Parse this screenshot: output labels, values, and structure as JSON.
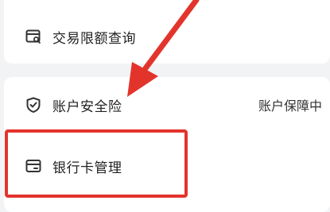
{
  "menu": {
    "items": [
      {
        "id": "trade-limit",
        "label": "交易限额查询",
        "icon": "receipt-search-icon",
        "status": ""
      },
      {
        "id": "account-insurance",
        "label": "账户安全险",
        "icon": "shield-check-icon",
        "status": "账户保障中"
      },
      {
        "id": "bank-card",
        "label": "银行卡管理",
        "icon": "bank-card-icon",
        "status": ""
      }
    ]
  },
  "annotation": {
    "highlight_color": "#e3342c",
    "arrow_color": "#e3342c",
    "highlighted_item": "bank-card"
  }
}
